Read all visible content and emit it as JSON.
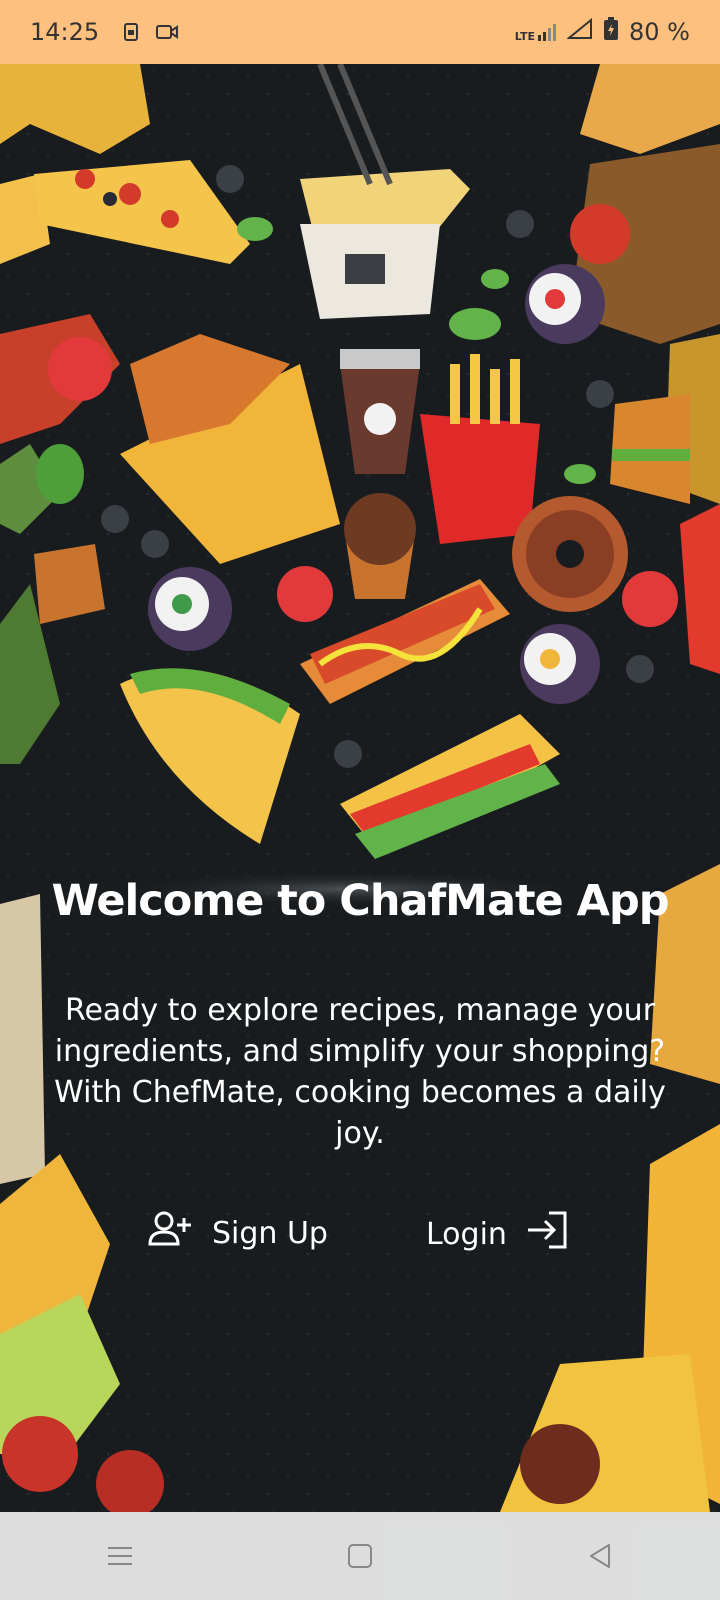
{
  "status_bar": {
    "time": "14:25",
    "battery": "80 %",
    "network": "LTE",
    "icons": [
      "sim-icon",
      "video-icon",
      "lte-signal-icon",
      "signal-icon",
      "battery-icon"
    ]
  },
  "welcome": {
    "title": "Welcome to ChafMate App",
    "subtitle": "Ready to explore recipes, manage your ingredients, and simplify your shopping? With ChefMate, cooking becomes a daily joy."
  },
  "actions": {
    "signup_label": "Sign Up",
    "signup_icon": "add-user-icon",
    "login_label": "Login",
    "login_icon": "login-icon"
  },
  "nav_bar": {
    "icons": [
      "menu-icon",
      "home-icon",
      "back-icon"
    ]
  },
  "colors": {
    "status_bar": "#fec07e",
    "background": "#181c1f",
    "text": "#ffffff"
  }
}
